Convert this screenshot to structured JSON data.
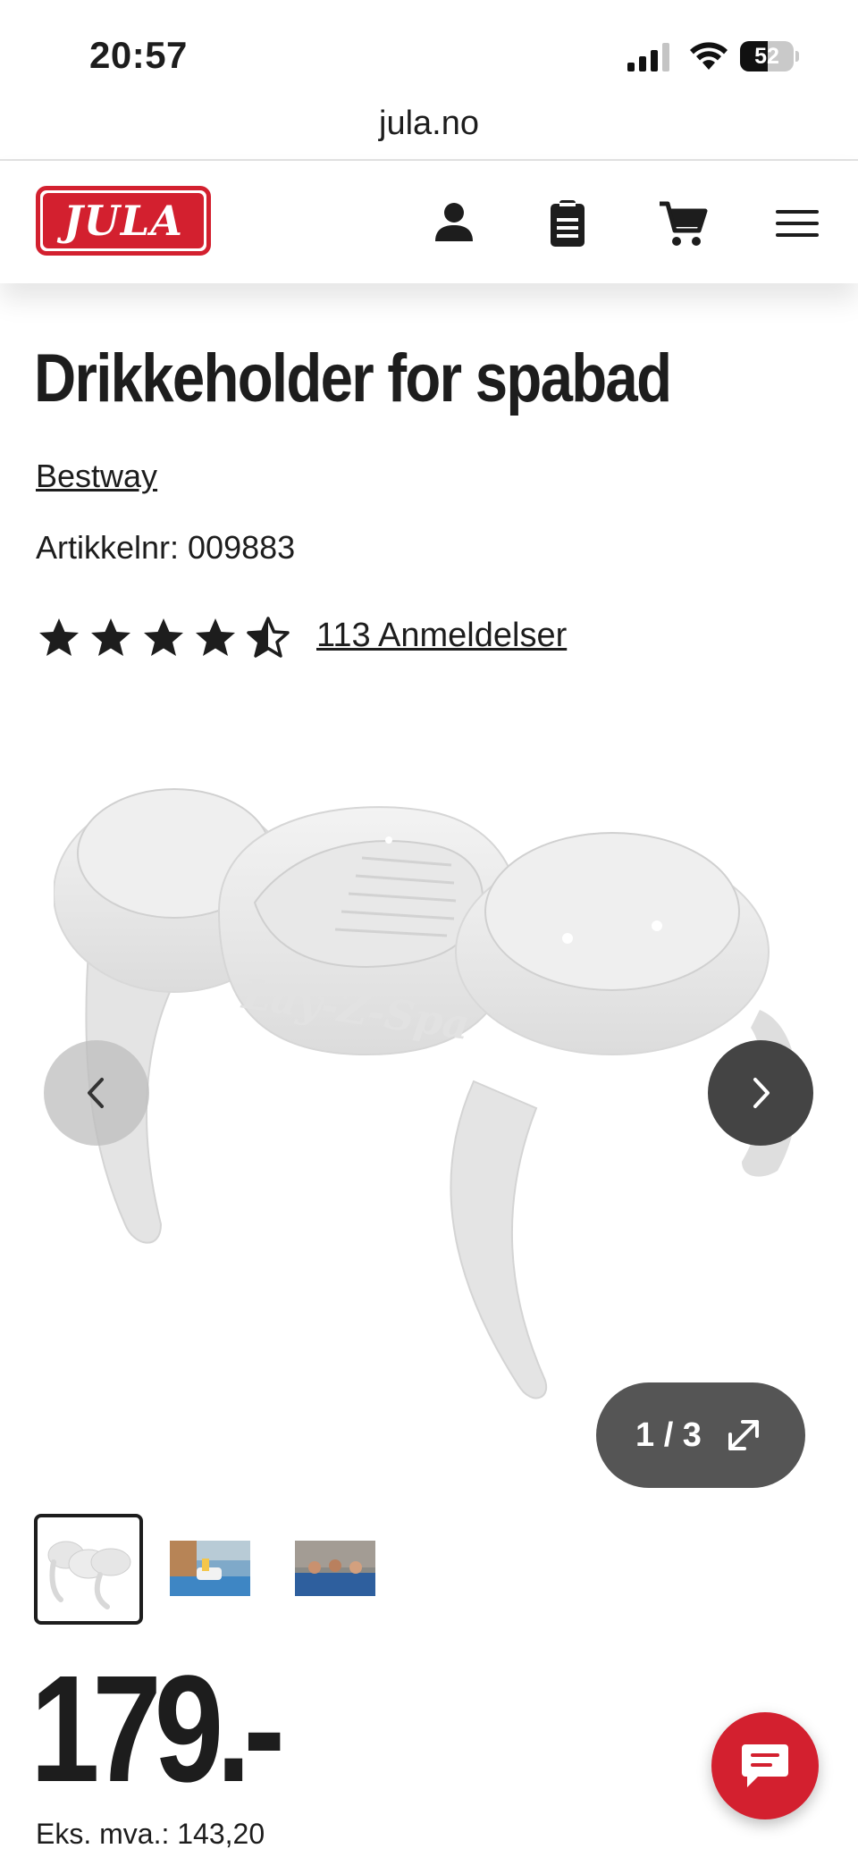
{
  "status_bar": {
    "time": "20:57",
    "battery_percent": "52",
    "battery_level": 0.52,
    "icons": [
      "cellular-signal-icon",
      "wifi-icon",
      "battery-icon"
    ]
  },
  "browser": {
    "url": "jula.no"
  },
  "header": {
    "logo_text": "JULA",
    "brand_color": "#d3202f",
    "icons": [
      "account-icon",
      "shopping-list-icon",
      "cart-icon",
      "menu-icon"
    ]
  },
  "product": {
    "title": "Drikkeholder for spabad",
    "brand": "Bestway",
    "article_number": "Artikkelnr: 009883",
    "rating": 4.5,
    "rating_max": 5,
    "reviews_label": "113 Anmeldelser",
    "price": "179.-",
    "price_ex_vat": "Eks. mva.: 143,20"
  },
  "gallery": {
    "counter": "1 / 3",
    "current_image": 1,
    "total_images": 3,
    "image_label": "Lay-Z-Spa",
    "thumbnails": [
      "drink-holder-product",
      "pool-side-drink-holder",
      "people-in-hot-tub"
    ]
  },
  "chat": {
    "icon": "chat-icon",
    "color": "#d3202f"
  }
}
